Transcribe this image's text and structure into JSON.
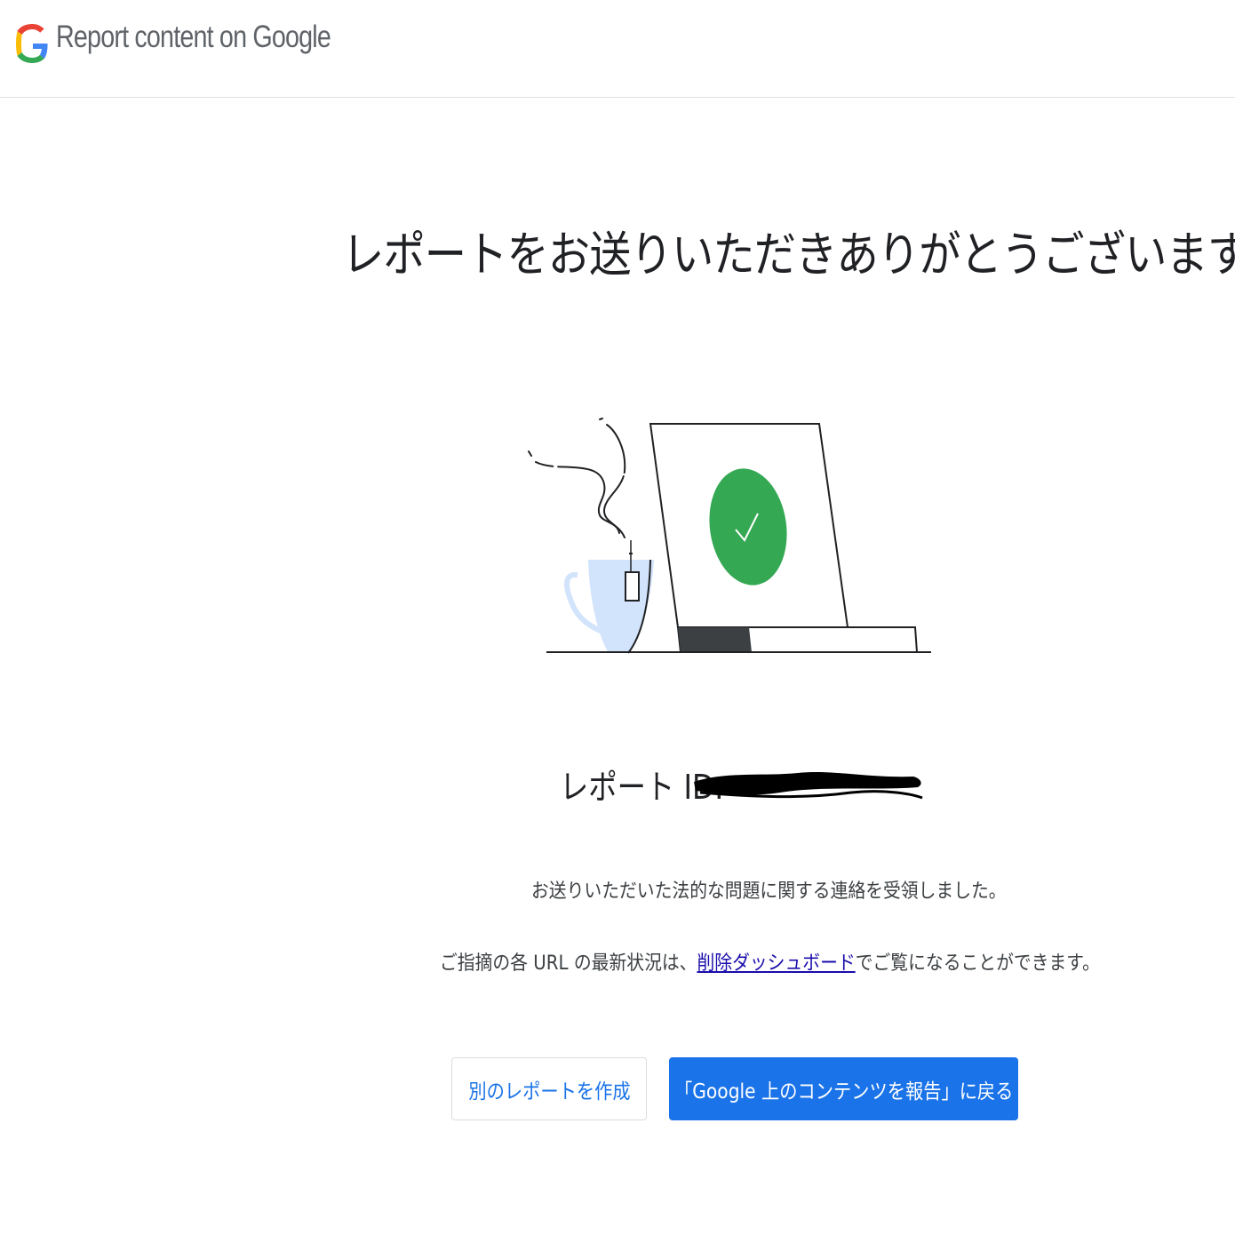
{
  "header": {
    "logo_icon": "google-g-logo-icon",
    "title": "Report content on Google"
  },
  "main": {
    "heading": "レポートをお送りいただきありがとうございます",
    "illustration_icon": "laptop-checkmark-coffee-illustration",
    "report_id_label": "レポート ID:",
    "message_1": "お送りいただいた法的な問題に関する連絡を受領しました。",
    "message_2_prefix": "ご指摘の各 URL の最新状況は、",
    "message_2_link": "削除ダッシュボード",
    "message_2_suffix": "でご覧になることができます。"
  },
  "actions": {
    "new_report_label": "別のレポートを作成",
    "back_label": "「Google 上のコンテンツを報告」に戻る"
  },
  "colors": {
    "primary": "#1a73e8",
    "check_green": "#34a853",
    "cup_fill": "#d2e3fc",
    "link": "#1a0dab"
  }
}
